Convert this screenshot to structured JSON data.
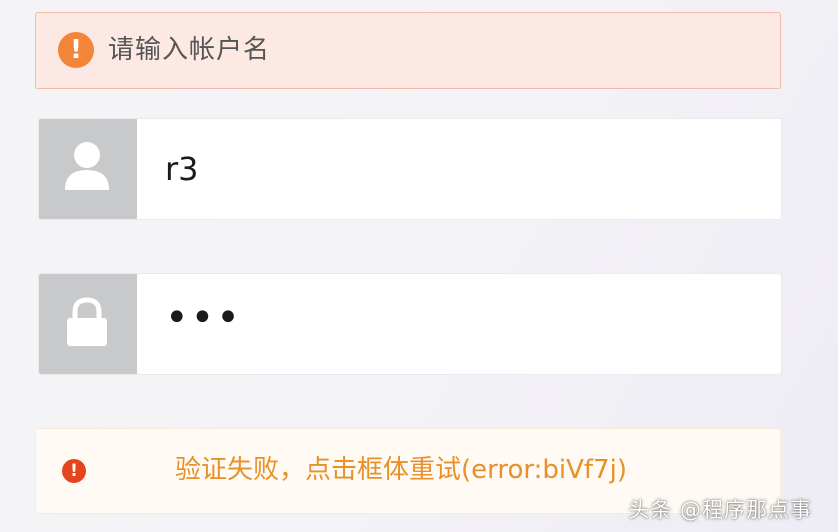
{
  "alert_top": {
    "icon": "exclamation-icon",
    "message": "请输入帐户名",
    "color": "#f2853a"
  },
  "username": {
    "icon": "user-icon",
    "value": "r3"
  },
  "password": {
    "icon": "lock-icon",
    "value": "•••"
  },
  "captcha_alert": {
    "icon": "error-icon",
    "message": "验证失败，点击框体重试(error:biVf7j)",
    "color": "#e8912a"
  },
  "watermark": {
    "text": "头条 @程序那点事"
  }
}
